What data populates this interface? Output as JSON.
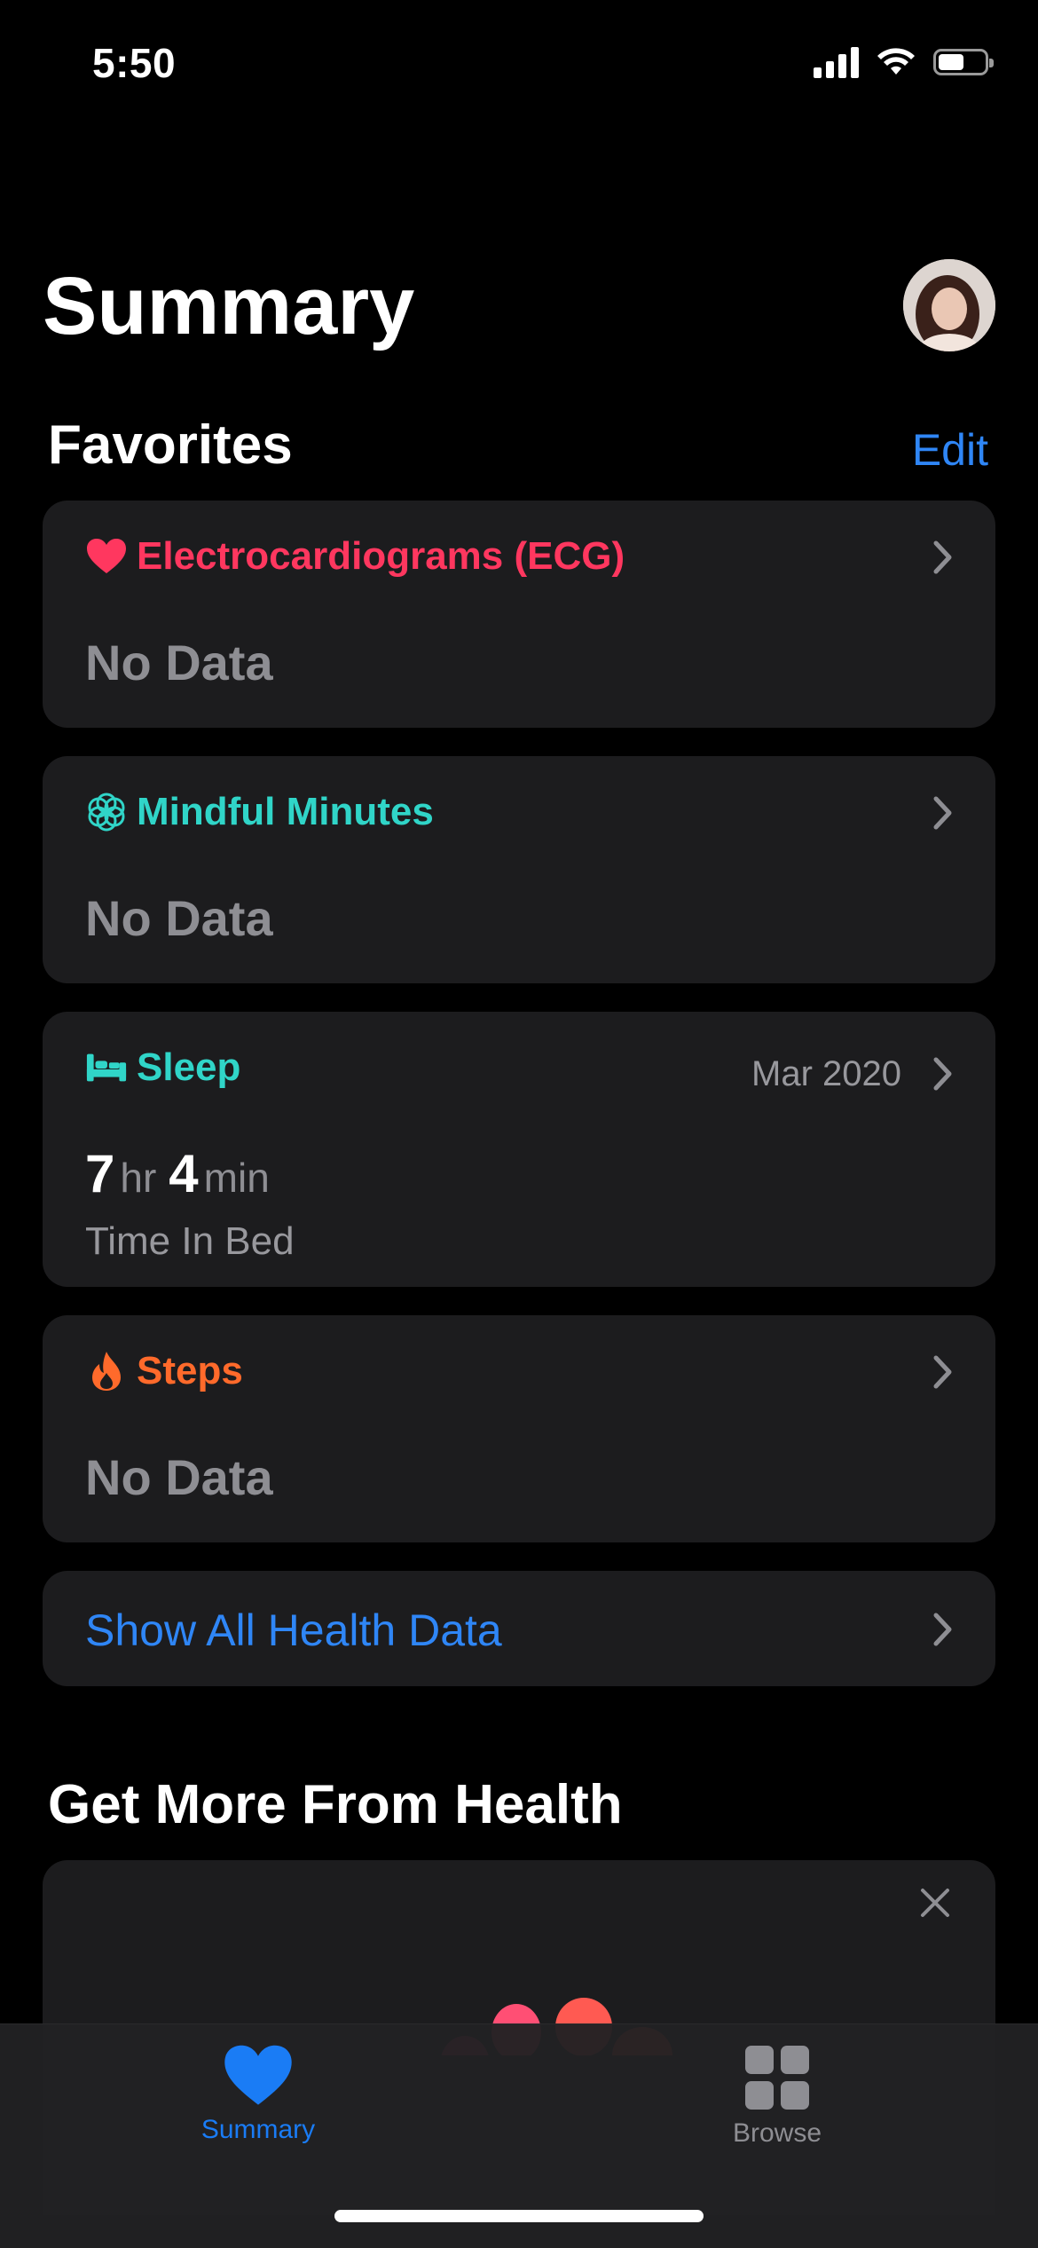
{
  "status_bar": {
    "time": "5:50",
    "battery_level": 0.55
  },
  "header": {
    "title": "Summary"
  },
  "favorites": {
    "title": "Favorites",
    "edit_label": "Edit",
    "cards": [
      {
        "title": "Electrocardiograms (ECG)",
        "icon": "heart-icon",
        "color": "#ff375f",
        "value": "No Data"
      },
      {
        "title": "Mindful Minutes",
        "icon": "mindfulness-flower-icon",
        "color": "#30d5c8",
        "value": "No Data"
      },
      {
        "title": "Sleep",
        "icon": "bed-icon",
        "color": "#30d5c8",
        "date": "Mar 2020",
        "hours": "7",
        "hours_unit": "hr",
        "minutes": "4",
        "minutes_unit": "min",
        "subtitle": "Time In Bed"
      },
      {
        "title": "Steps",
        "icon": "flame-icon",
        "color": "#ff6a2b",
        "value": "No Data"
      }
    ],
    "show_all_label": "Show All Health Data"
  },
  "get_more": {
    "title": "Get More From Health"
  },
  "tab_bar": {
    "tabs": [
      {
        "label": "Summary",
        "icon": "heart-icon",
        "active": true,
        "color": "#1a7cf5"
      },
      {
        "label": "Browse",
        "icon": "grid-icon",
        "active": false,
        "color": "#8e8e93"
      }
    ]
  }
}
